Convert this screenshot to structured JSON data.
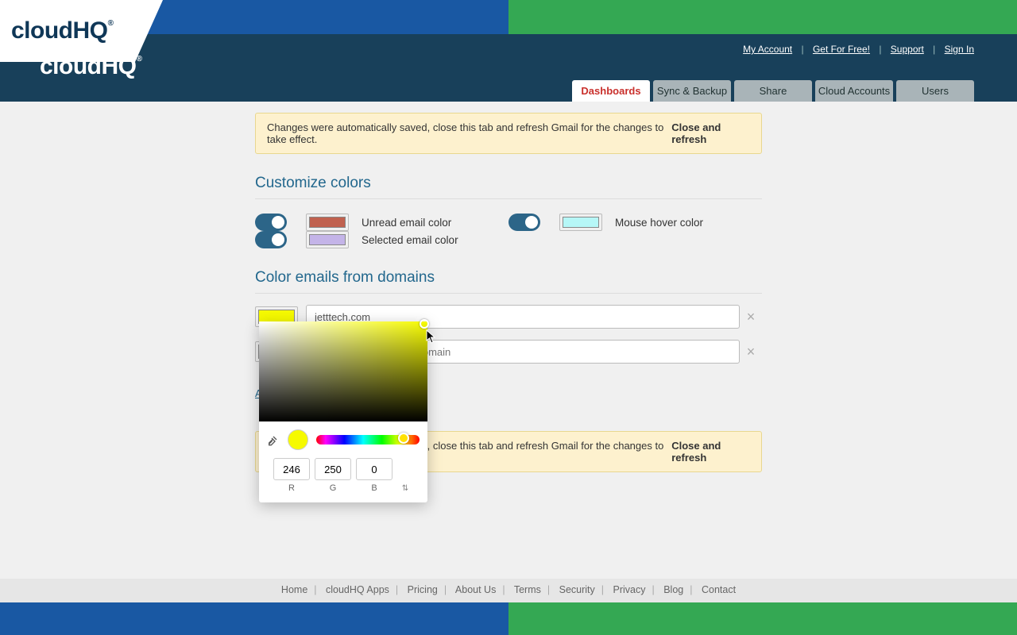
{
  "brand": "cloudHQ",
  "top_links": {
    "my_account": "My Account",
    "get_free": "Get For Free!",
    "support": "Support",
    "sign_in": "Sign In"
  },
  "tabs": {
    "dashboards": "Dashboards",
    "sync_backup": "Sync & Backup",
    "share": "Share",
    "cloud_accounts": "Cloud Accounts",
    "users": "Users"
  },
  "notice": {
    "text": "Changes were automatically saved, close this tab and refresh Gmail for the changes to take effect.",
    "action": "Close and refresh"
  },
  "sections": {
    "customize": "Customize colors",
    "domains": "Color emails from domains"
  },
  "colors": {
    "unread": {
      "label": "Unread email color",
      "swatch": "#c0614f"
    },
    "selected": {
      "label": "Selected email color",
      "swatch": "#c4b4e8"
    },
    "hover": {
      "label": "Mouse hover color",
      "swatch": "#b6f7f7"
    }
  },
  "domains": [
    {
      "swatch": "#f6fa00",
      "value": "jetttech.com"
    },
    {
      "swatch": "#ffffff",
      "value": ""
    }
  ],
  "domain_placeholder": "Enter full email or just domain",
  "add_domain": "Add domain",
  "picker": {
    "preview": "#f6fa00",
    "r": "246",
    "g": "250",
    "b": "0",
    "r_label": "R",
    "g_label": "G",
    "b_label": "B"
  },
  "footer": {
    "home": "Home",
    "apps": "cloudHQ Apps",
    "pricing": "Pricing",
    "about": "About Us",
    "terms": "Terms",
    "security": "Security",
    "privacy": "Privacy",
    "blog": "Blog",
    "contact": "Contact"
  }
}
